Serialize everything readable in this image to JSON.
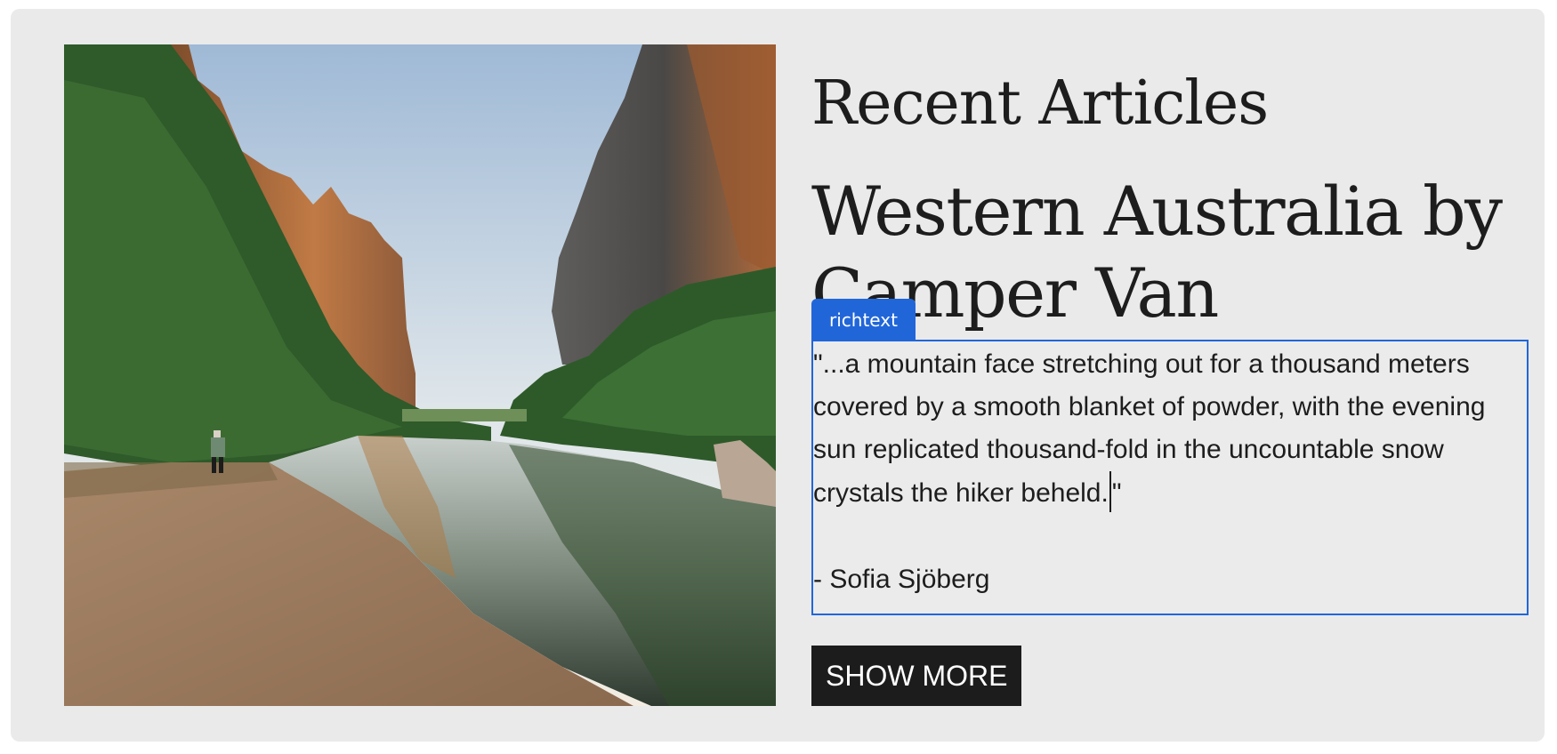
{
  "section": {
    "title": "Recent Articles"
  },
  "article": {
    "title": "Western Australia by Camper Van",
    "quote_before_cursor": "\"...a mountain face stretching out for a thousand meters covered by a smooth blanket of powder, with the evening sun replicated thousand-fold in the uncountable snow crystals the hiker beheld.",
    "quote_after_cursor": "\"",
    "author": "- Sofia Sjöberg"
  },
  "editor": {
    "richtext_tag": "richtext"
  },
  "actions": {
    "show_more_label": "SHOW MORE"
  },
  "image": {
    "icon": "canyon-river-photo"
  },
  "colors": {
    "card_background": "#eaeaea",
    "editor_accent": "#2166d9",
    "button_background": "#1c1c1c",
    "text": "#1d1d1d"
  }
}
